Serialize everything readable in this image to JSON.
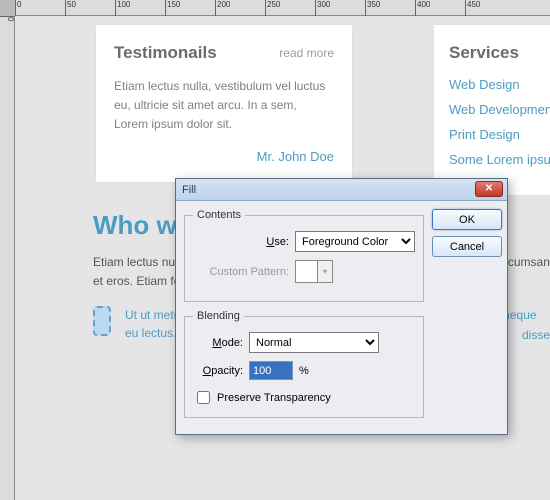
{
  "ruler": {
    "h": [
      "0",
      "50",
      "100",
      "150",
      "200",
      "250",
      "300",
      "350",
      "400",
      "450"
    ],
    "v": [
      "0"
    ]
  },
  "testimonials": {
    "title": "Testimonails",
    "read_more": "read more",
    "body": "Etiam lectus nulla, vestibulum vel luctus eu, ultricie sit amet arcu. In a sem, Lorem ipsum dolor sit.",
    "author": "Mr. John Doe"
  },
  "services": {
    "title": "Services",
    "links": [
      "Web Design",
      "Web Development",
      "Print Design",
      "Some Lorem ipsu"
    ]
  },
  "who": {
    "title": "Who we",
    "body": "Etiam lectus nulla, sed orci in, laoreet vestibulum et in a sem a nibh fringilla accumsan et eros. Etiam feugiat per a quis ante. Suspendisse potenti.",
    "bullet": "Ut ut metus, ac das adipis elemen tum. Suspen disse Fusce commodo neque eu lectus.",
    "right_frag": "disse"
  },
  "dialog": {
    "title": "Fill",
    "ok": "OK",
    "cancel": "Cancel",
    "contents": {
      "legend": "Contents",
      "use_label": "Use:",
      "use_value": "Foreground Color",
      "custom_label": "Custom Pattern:"
    },
    "blending": {
      "legend": "Blending",
      "mode_label": "Mode:",
      "mode_value": "Normal",
      "opacity_label": "Opacity:",
      "opacity_value": "100",
      "opacity_suffix": "%",
      "preserve": "Preserve Transparency"
    }
  }
}
